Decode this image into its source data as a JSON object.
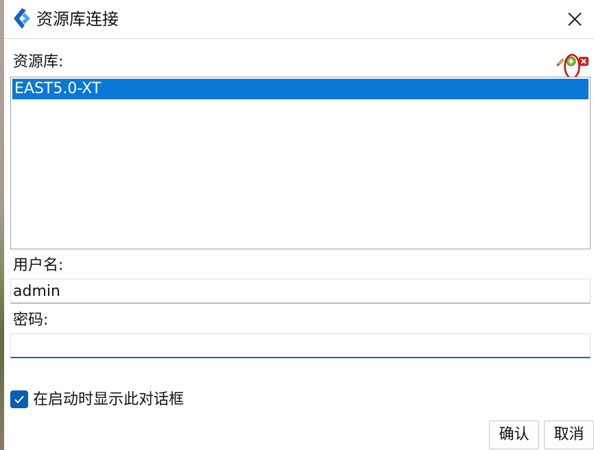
{
  "window": {
    "title": "资源库连接",
    "close_icon": "close-icon",
    "app_icon": "app-logo-icon"
  },
  "repository": {
    "label": "资源库:",
    "items": [
      "EAST5.0-XT"
    ],
    "selected_index": 0,
    "tools": {
      "edit_icon": "pencil-edit-icon",
      "add_icon": "green-plus-add-icon",
      "delete_icon": "red-x-delete-icon"
    }
  },
  "username": {
    "label": "用户名:",
    "value": "admin"
  },
  "password": {
    "label": "密码:",
    "value": ""
  },
  "show_on_startup": {
    "label": "在启动时显示此对话框",
    "checked": true
  },
  "buttons": {
    "ok_label": "确认",
    "cancel_label": "取消"
  },
  "colors": {
    "accent": "#0a78d7",
    "checkbox": "#0a5fb4",
    "annotation": "#e00000"
  }
}
